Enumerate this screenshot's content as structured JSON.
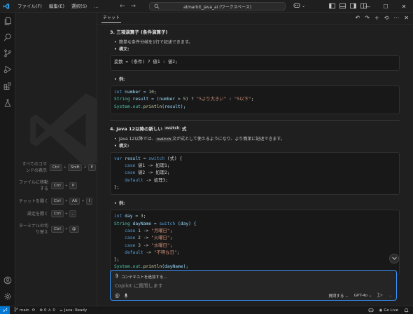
{
  "titlebar": {
    "menus": [
      "ファイル(F)",
      "編集(E)",
      "選択(S)",
      "…"
    ],
    "search_text": "atmarkit_java_ai (ワークスペース)"
  },
  "shortcuts": [
    {
      "label": "すべてのコマンドの表示",
      "keys": [
        "Ctrl",
        "+",
        "Shift",
        "+",
        "P"
      ]
    },
    {
      "label": "ファイルに移動する",
      "keys": [
        "Ctrl",
        "+",
        "P"
      ]
    },
    {
      "label": "チャットを開く",
      "keys": [
        "Ctrl",
        "+",
        "Alt",
        "+",
        "I"
      ]
    },
    {
      "label": "設定を開く",
      "keys": [
        "Ctrl",
        "+",
        ","
      ]
    },
    {
      "label": "ターミナルの切り替え",
      "keys": [
        "Ctrl",
        "+",
        "@"
      ]
    }
  ],
  "chat": {
    "tab": "チャット",
    "section3": {
      "title": "3. 三項演算子 (条件演算子)",
      "bullet1": "簡単な条件分岐を1行で記述できます。",
      "bullet2": "構文:",
      "syntax_a": "変数 = (条件) ? 値1 : 値2;",
      "bullet3": "例:",
      "ex_l1a": "int",
      "ex_l1b": " number = ",
      "ex_l1c": "10",
      "ex_l1d": ";",
      "ex_l2a": "String",
      "ex_l2b": " result = (number > ",
      "ex_l2c": "5",
      "ex_l2d": ") ? ",
      "ex_l2e": "\"5より大きい\"",
      "ex_l2f": " : ",
      "ex_l2g": "\"5以下\"",
      "ex_l2h": ";",
      "ex_l3a": "System.out.",
      "ex_l3b": "println",
      "ex_l3c": "(result);"
    },
    "section4": {
      "title_a": "4. Java 12以降の新しい",
      "title_code": "switch",
      "title_b": "式",
      "bullet1_a": "Java 12以降では、",
      "bullet1_code": "switch",
      "bullet1_b": "文が式として使えるようになり、より簡潔に記述できます。",
      "bullet2": "構文:",
      "syn_l1a": "var",
      "syn_l1b": " result = ",
      "syn_l1c": "switch",
      "syn_l1d": " (式) {",
      "syn_l2a": "case",
      "syn_l2b": " 値1 -> 処理1;",
      "syn_l3a": "case",
      "syn_l3b": " 値2 -> 処理2;",
      "syn_l4a": "default",
      "syn_l4b": " -> 処理3;",
      "syn_l5": "};",
      "bullet3": "例:",
      "ex_l1a": "int",
      "ex_l1b": " day = ",
      "ex_l1c": "3",
      "ex_l1d": ";",
      "ex_l2a": "String",
      "ex_l2b": " dayName = ",
      "ex_l2c": "switch",
      "ex_l2d": " (day) {",
      "ex_c1a": "case",
      "ex_c1b": "1",
      "ex_c1c": "\"月曜日\"",
      "ex_c2a": "case",
      "ex_c2b": "2",
      "ex_c2c": "\"火曜日\"",
      "ex_c3a": "case",
      "ex_c3b": "3",
      "ex_c3c": "\"水曜日\"",
      "ex_c4a": "default",
      "ex_c4c": "\"不明な日\"",
      "ex_end": "};",
      "ex_p1": "System.out.",
      "ex_p2": "println",
      "ex_p3": "(dayName);"
    },
    "input": {
      "context_label": "コンテキストを追加する...",
      "placeholder": "Copilot に質問します",
      "mode": "質問する",
      "model": "GPT-4o"
    }
  },
  "statusbar": {
    "branch": "main",
    "errors": "0",
    "warnings": "0",
    "java": "Java: Ready",
    "golive": "Go Live"
  },
  "colors": {
    "accent": "#0078d4",
    "focus_border": "#3794ff",
    "background": "#1f1f1f"
  }
}
